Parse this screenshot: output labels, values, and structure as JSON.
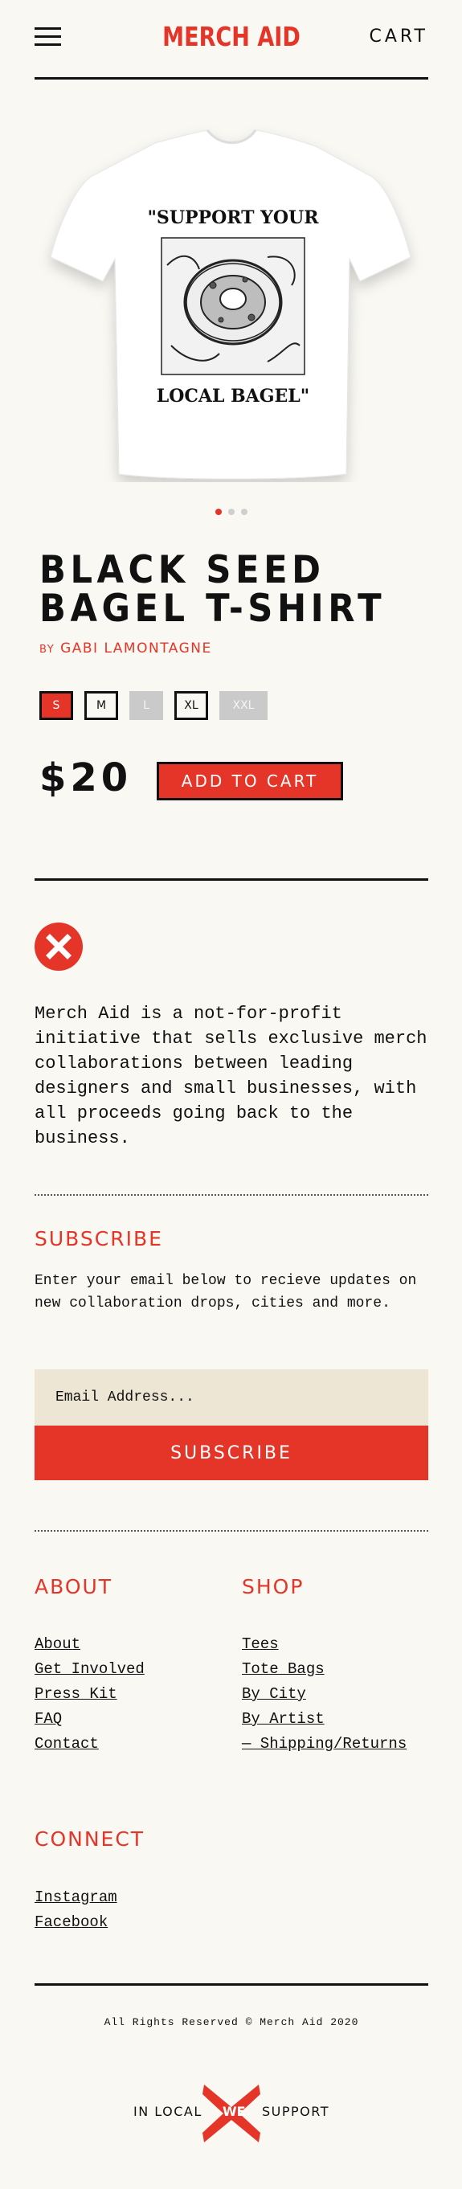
{
  "header": {
    "menu_icon": "hamburger-menu-icon",
    "logo": "MERCH AID",
    "cart": "CART"
  },
  "product": {
    "image_alt": "white t-shirt with Support Your Local Bagel print",
    "tshirt_print_top": "\"SUPPORT YOUR",
    "tshirt_print_bottom": "LOCAL BAGEL\"",
    "title": "BLACK SEED BAGEL T-SHIRT",
    "by": "BY",
    "artist": "GABI LAMONTAGNE",
    "sizes": [
      {
        "label": "S",
        "state": "selected"
      },
      {
        "label": "M",
        "state": "available"
      },
      {
        "label": "L",
        "state": "unavailable"
      },
      {
        "label": "XL",
        "state": "available"
      },
      {
        "label": "XXL",
        "state": "unavailable"
      }
    ],
    "price": "$20",
    "add_to_cart": "ADD TO CART",
    "slides": 3,
    "active_slide": 1
  },
  "about": {
    "icon": "x-circle-icon",
    "text": "Merch Aid is a not-for-profit initiative that sells exclusive merch collaborations between leading designers and small businesses, with all proceeds going back to the business."
  },
  "subscribe": {
    "heading": "SUBSCRIBE",
    "text": "Enter your email below to recieve updates on new collaboration drops, cities and more.",
    "placeholder": "Email Address...",
    "button": "SUBSCRIBE"
  },
  "footer": {
    "about_heading": "ABOUT",
    "about_links": [
      "About",
      "Get Involved",
      "Press Kit",
      "FAQ",
      "Contact"
    ],
    "shop_heading": "SHOP",
    "shop_links": [
      "Tees",
      "Tote Bags",
      "By City",
      "By Artist",
      "— Shipping/Returns"
    ],
    "connect_heading": "CONNECT",
    "connect_links": [
      "Instagram",
      "Facebook"
    ],
    "copyright": "All Rights Reserved © Merch Aid 2020",
    "bottom_logo_left": "IN LOCAL",
    "bottom_logo_center": "WE",
    "bottom_logo_right": "SUPPORT"
  },
  "colors": {
    "accent": "#e53528",
    "background": "#f9f8f3",
    "input_bg": "#ede6d4",
    "unavailable": "#cacaca"
  }
}
